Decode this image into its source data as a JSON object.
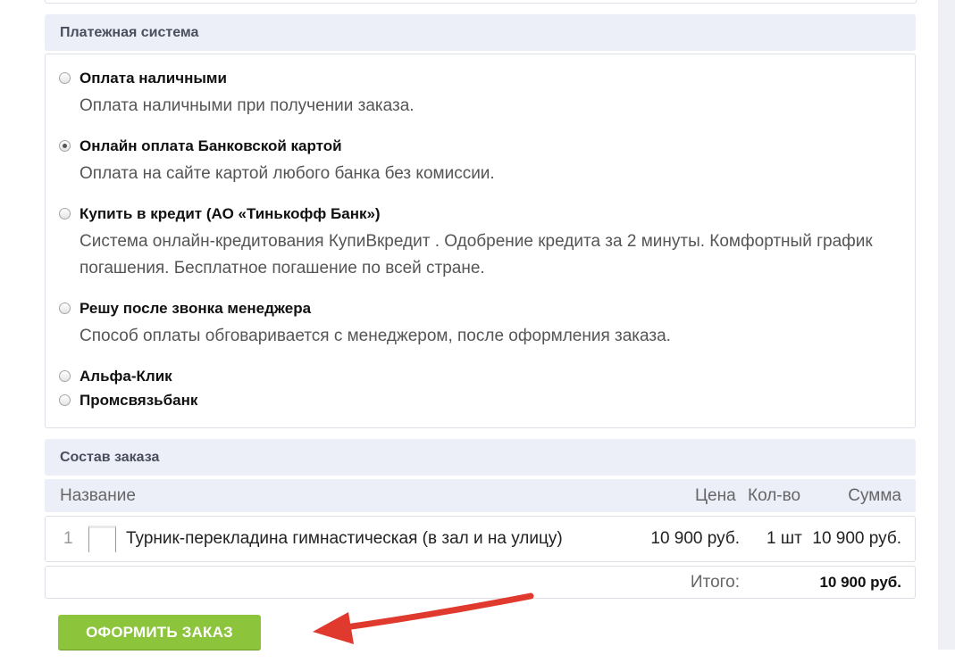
{
  "payment": {
    "header": "Платежная система",
    "options": [
      {
        "title": "Оплата наличными",
        "desc": "Оплата наличными при получении заказа.",
        "checked": false
      },
      {
        "title": "Онлайн оплата Банковской картой",
        "desc": "Оплата на сайте картой любого банка без комиссии.",
        "checked": true
      },
      {
        "title": "Купить в кредит (АО «Тинькофф Банк»)",
        "desc": "Система онлайн-кредитования КупиВкредит . Одобрение кредита за 2 минуты. Комфортный график погашения. Бесплатное погашение по всей стране.",
        "checked": false
      },
      {
        "title": "Решу после звонка менеджера",
        "desc": "Способ оплаты обговаривается с менеджером, после оформления заказа.",
        "checked": false
      },
      {
        "title": "Альфа-Клик",
        "desc": "",
        "checked": false
      },
      {
        "title": "Промсвязьбанк",
        "desc": "",
        "checked": false
      }
    ]
  },
  "order": {
    "header": "Состав заказа",
    "columns": {
      "name": "Название",
      "price": "Цена",
      "qty": "Кол-во",
      "sum": "Сумма"
    },
    "items": [
      {
        "num": "1",
        "name": "Турник-перекладина гимнастическая (в зал и на улицу)",
        "price": "10 900 руб.",
        "qty": "1 шт",
        "sum": "10 900 руб."
      }
    ],
    "total_label": "Итого:",
    "total_value": "10 900 руб."
  },
  "submit_label": "ОФОРМИТЬ ЗАКАЗ",
  "colors": {
    "accent_button": "#8cc43c",
    "arrow": "#e03a2e",
    "header_bg": "#eceef8"
  }
}
